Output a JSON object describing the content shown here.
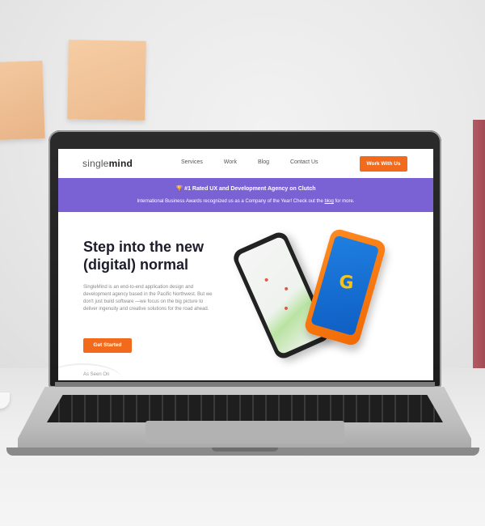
{
  "site": {
    "logo": {
      "part1": "single",
      "part2": "mind"
    },
    "nav": {
      "links": [
        "Services",
        "Work",
        "Blog",
        "Contact Us"
      ],
      "cta": "Work With Us"
    },
    "banner": {
      "headline_icon": "trophy-icon",
      "headline": "#1 Rated UX and Development Agency on Clutch",
      "subtext_before": "International Business Awards recognized us as a Company of the Year! Check out the ",
      "subtext_link": "blog",
      "subtext_after": " for more."
    },
    "hero": {
      "title": "Step into the new (digital) normal",
      "body": "SingleMind is an end-to-end application design and development agency based in the Pacific Northwest. But we don't just build software —we focus on the big picture to deliver ingenuity and creative solutions for the road ahead.",
      "cta": "Get Started",
      "seen_label": "As Seen On"
    }
  },
  "colors": {
    "accent": "#f26b1d",
    "banner": "#7a62d4",
    "text_dark": "#1c1c2a"
  }
}
